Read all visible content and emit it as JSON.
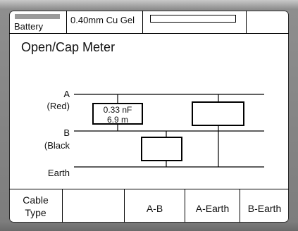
{
  "status": {
    "battery_label": "Battery",
    "cable_label": "0.40mm Cu Gel",
    "progress_percent": 0
  },
  "title": "Open/Cap Meter",
  "diagram": {
    "label_a": "A",
    "label_a_sub": "(Red)",
    "label_b": "B",
    "label_b_sub": "(Black",
    "label_earth": "Earth",
    "ab_capacitance": "0.33 nF",
    "ab_distance": "6.9 m",
    "a_earth_value": "",
    "b_earth_value": ""
  },
  "softkeys": {
    "key1_line1": "Cable",
    "key1_line2": "Type",
    "key2": "",
    "key3": "A-B",
    "key4": "A-Earth",
    "key5": "B-Earth"
  },
  "colors": {
    "screen": "#ffffff",
    "bezel": "#8e8e8e",
    "ink": "#111111",
    "battery_fill": "#9a9a9a"
  }
}
